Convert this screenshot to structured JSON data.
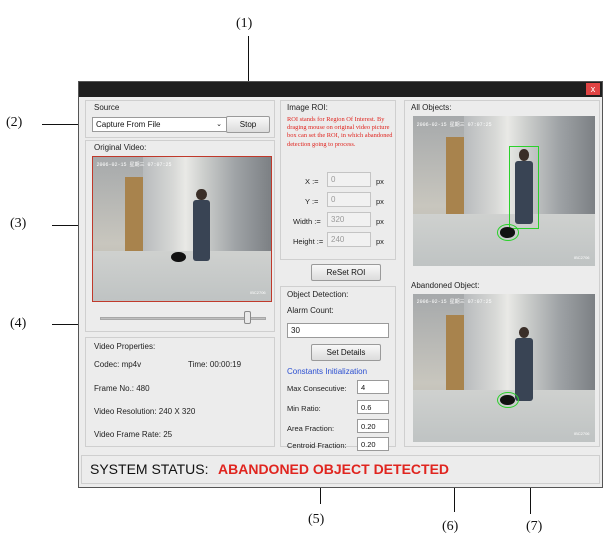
{
  "callouts": [
    "(1)",
    "(2)",
    "(3)",
    "(4)",
    "(5)",
    "(6)",
    "(7)"
  ],
  "window": {
    "close_label": "x"
  },
  "source": {
    "label": "Source",
    "selected": "Capture From File",
    "stop_label": "Stop"
  },
  "original_video": {
    "label": "Original Video:",
    "timestamp": "2006-02-15 星期三 07:07:25",
    "watermark": "IBC2706",
    "slider": {
      "value_fraction": 0.88
    }
  },
  "image_roi": {
    "label": "Image ROI:",
    "description": "ROI stands for Region Of Interest. By draging mouse on original video picture box can set the ROI, in which abandoned detection going to process.",
    "fields": [
      {
        "label": "X :=",
        "value": "0",
        "unit": "px"
      },
      {
        "label": "Y :=",
        "value": "0",
        "unit": "px"
      },
      {
        "label": "Width :=",
        "value": "320",
        "unit": "px"
      },
      {
        "label": "Height :=",
        "value": "240",
        "unit": "px"
      }
    ],
    "reset_label": "ReSet ROI"
  },
  "object_detection": {
    "label": "Object Detection:",
    "alarm_label": "Alarm Count:",
    "alarm_value": "30",
    "set_details_label": "Set Details",
    "constants_label": "Constants Initialization",
    "constants": [
      {
        "label": "Max Consecutive:",
        "value": "4"
      },
      {
        "label": "Min Ratio:",
        "value": "0.6"
      },
      {
        "label": "Area Fraction:",
        "value": "0.20"
      },
      {
        "label": "Centroid Fraction:",
        "value": "0.20"
      }
    ]
  },
  "video_properties": {
    "label": "Video Properties:",
    "codec": "Codec: mp4v",
    "time": "Time: 00:00:19",
    "frame_no": "Frame No.: 480",
    "resolution": "Video Resolution: 240 X 320",
    "frame_rate": "Video Frame Rate: 25"
  },
  "all_objects": {
    "label": "All Objects:"
  },
  "abandoned_object": {
    "label": "Abandoned Object:"
  },
  "status": {
    "label": "SYSTEM STATUS:",
    "value": "ABANDONED OBJECT DETECTED"
  },
  "colors": {
    "roi_text": "#e0251f",
    "status_value": "#e0251f",
    "constants_label": "#2b4fd1",
    "video_border": "#c0392b"
  }
}
